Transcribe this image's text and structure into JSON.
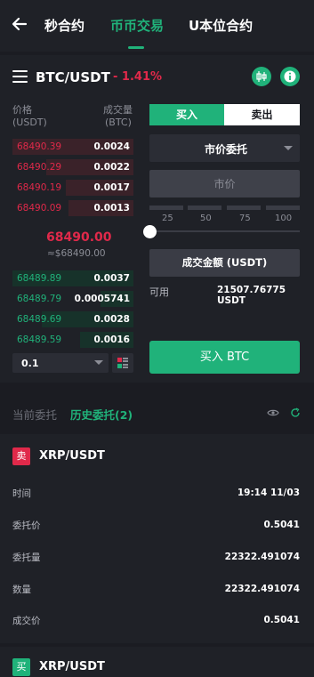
{
  "nav": {
    "tabs": [
      {
        "label": "秒合约"
      },
      {
        "label": "币币交易"
      },
      {
        "label": "U本位合约"
      }
    ]
  },
  "ticker": {
    "pair": "BTC/USDT",
    "change": "- 1.41%"
  },
  "orderbook": {
    "price_header": "价格",
    "price_unit": "(USDT)",
    "qty_header": "成交量",
    "qty_unit": "(BTC)",
    "asks": [
      {
        "price": "68490.39",
        "qty": "0.0024",
        "depth": 1.0
      },
      {
        "price": "68490.29",
        "qty": "0.0022",
        "depth": 0.72
      },
      {
        "price": "68490.19",
        "qty": "0.0017",
        "depth": 0.56
      },
      {
        "price": "68490.09",
        "qty": "0.0013",
        "depth": 0.54
      }
    ],
    "last_price": "68490.00",
    "last_price_usd": "≈$68490.00",
    "bids": [
      {
        "price": "68489.89",
        "qty": "0.0037",
        "depth": 1.0
      },
      {
        "price": "68489.79",
        "qty": "0.0005741",
        "depth": 0.27
      },
      {
        "price": "68489.69",
        "qty": "0.0028",
        "depth": 0.76
      },
      {
        "price": "68489.59",
        "qty": "0.0016",
        "depth": 0.44
      }
    ],
    "precision": "0.1"
  },
  "form": {
    "buy_tab": "买入",
    "sell_tab": "卖出",
    "order_type": "市价委托",
    "price_placeholder": "市价",
    "percents": [
      "25",
      "50",
      "75",
      "100"
    ],
    "slider_value": 0,
    "amount_label": "成交金额 (USDT)",
    "available_label": "可用",
    "available_value": "21507.76775 USDT",
    "submit_label": "买入 BTC"
  },
  "orders": {
    "tab_current": "当前委托",
    "tab_history": "历史委托(2)",
    "cards": [
      {
        "side": "卖",
        "pair": "XRP/USDT",
        "fields": [
          {
            "label": "时间",
            "value": "19:14 11/03"
          },
          {
            "label": "委托价",
            "value": "0.5041"
          },
          {
            "label": "委托量",
            "value": "22322.491074"
          },
          {
            "label": "数量",
            "value": "22322.491074"
          },
          {
            "label": "成交价",
            "value": "0.5041"
          }
        ]
      },
      {
        "side": "买",
        "pair": "XRP/USDT"
      }
    ]
  },
  "colors": {
    "accent_green": "#20b27a",
    "accent_red": "#e0294a",
    "bg": "#1b1c22",
    "panel": "#1f2127"
  }
}
